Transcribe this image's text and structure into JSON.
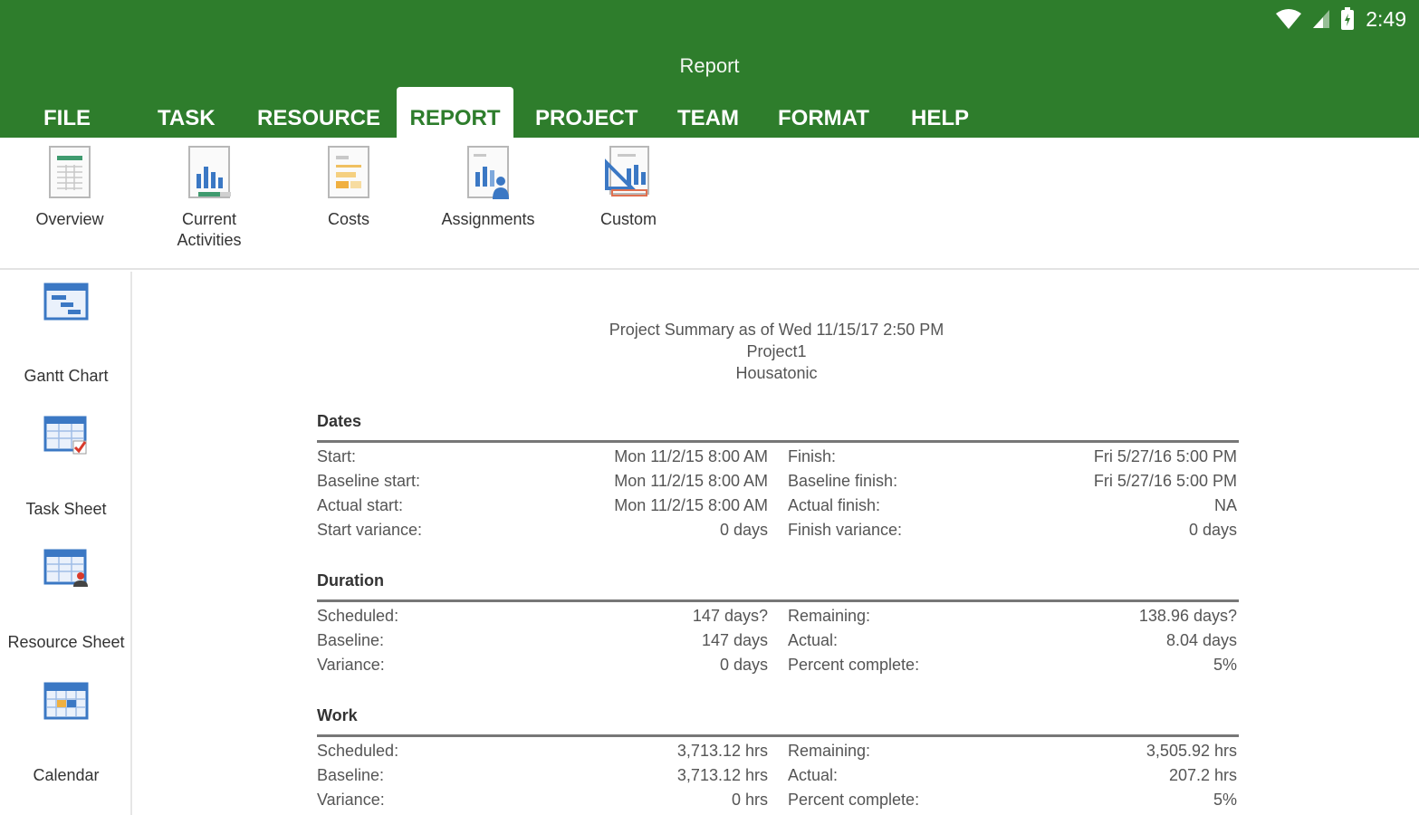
{
  "status_bar": {
    "time": "2:49"
  },
  "app": {
    "title": "Report"
  },
  "tabs": [
    {
      "label": "FILE"
    },
    {
      "label": "TASK"
    },
    {
      "label": "RESOURCE"
    },
    {
      "label": "REPORT"
    },
    {
      "label": "PROJECT"
    },
    {
      "label": "TEAM"
    },
    {
      "label": "FORMAT"
    },
    {
      "label": "HELP"
    }
  ],
  "ribbon": {
    "items": [
      {
        "label": "Overview",
        "icon": "overview-report-icon"
      },
      {
        "label": "Current\nActivities",
        "icon": "current-activities-report-icon"
      },
      {
        "label": "Costs",
        "icon": "costs-report-icon"
      },
      {
        "label": "Assignments",
        "icon": "assignments-report-icon"
      },
      {
        "label": "Custom",
        "icon": "custom-report-icon"
      }
    ]
  },
  "sidebar": {
    "items": [
      {
        "label": "Gantt Chart",
        "icon": "gantt-chart-icon"
      },
      {
        "label": "Task Sheet",
        "icon": "task-sheet-icon"
      },
      {
        "label": "Resource Sheet",
        "icon": "resource-sheet-icon"
      },
      {
        "label": "Calendar",
        "icon": "calendar-icon"
      }
    ]
  },
  "report": {
    "heading_line1": "Project Summary as of Wed 11/15/17 2:50 PM",
    "heading_line2": "Project1",
    "heading_line3": "Housatonic",
    "sections": [
      {
        "title": "Dates",
        "rows": [
          [
            "Start:",
            "Mon 11/2/15 8:00 AM",
            "Finish:",
            "Fri 5/27/16 5:00 PM"
          ],
          [
            "Baseline start:",
            "Mon 11/2/15 8:00 AM",
            "Baseline finish:",
            "Fri 5/27/16 5:00 PM"
          ],
          [
            "Actual start:",
            "Mon 11/2/15 8:00 AM",
            "Actual finish:",
            "NA"
          ],
          [
            "Start variance:",
            "0 days",
            "Finish variance:",
            "0 days"
          ]
        ]
      },
      {
        "title": "Duration",
        "rows": [
          [
            "Scheduled:",
            "147 days?",
            "Remaining:",
            "138.96 days?"
          ],
          [
            "Baseline:",
            "147 days",
            "Actual:",
            "8.04 days"
          ],
          [
            "Variance:",
            "0 days",
            "Percent complete:",
            "5%"
          ]
        ]
      },
      {
        "title": "Work",
        "rows": [
          [
            "Scheduled:",
            "3,713.12 hrs",
            "Remaining:",
            "3,505.92 hrs"
          ],
          [
            "Baseline:",
            "3,713.12 hrs",
            "Actual:",
            "207.2 hrs"
          ],
          [
            "Variance:",
            "0 hrs",
            "Percent complete:",
            "5%"
          ]
        ]
      }
    ]
  },
  "colors": {
    "brand_green": "#2e7d2c",
    "icon_blue": "#3b78c4"
  }
}
